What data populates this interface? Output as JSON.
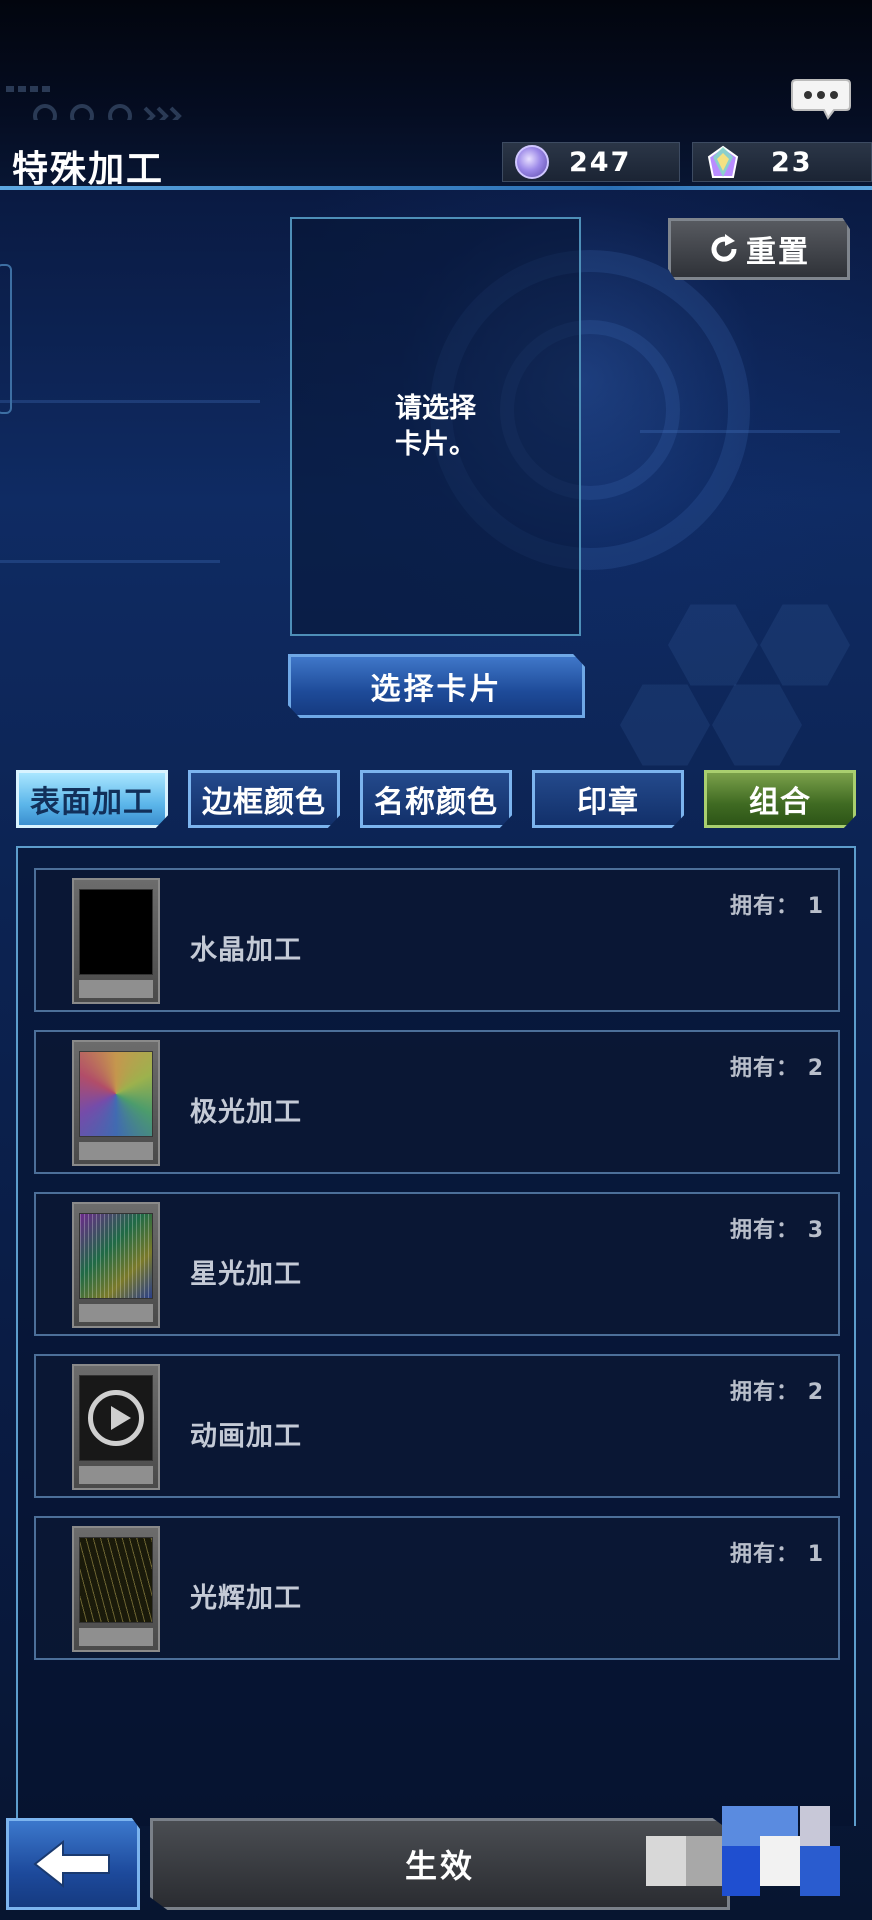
{
  "header": {
    "title": "特殊加工",
    "currencies": [
      {
        "name": "gem-currency",
        "value": "247"
      },
      {
        "name": "crystal-currency",
        "value": "23"
      }
    ]
  },
  "card_slot": {
    "prompt_line1": "请选择",
    "prompt_line2": "卡片。"
  },
  "reset_button": {
    "label": "重置"
  },
  "select_button": {
    "label": "选择卡片"
  },
  "tabs": [
    {
      "label": "表面加工",
      "state": "active"
    },
    {
      "label": "边框颜色",
      "state": "normal"
    },
    {
      "label": "名称颜色",
      "state": "normal"
    },
    {
      "label": "印章",
      "state": "normal"
    },
    {
      "label": "组合",
      "state": "green"
    }
  ],
  "owned_label": "拥有：",
  "items": [
    {
      "name": "水晶加工",
      "owned": "1",
      "art": "crystal"
    },
    {
      "name": "极光加工",
      "owned": "2",
      "art": "aurora"
    },
    {
      "name": "星光加工",
      "owned": "3",
      "art": "star"
    },
    {
      "name": "动画加工",
      "owned": "2",
      "art": "anim"
    },
    {
      "name": "光辉加工",
      "owned": "1",
      "art": "glow"
    }
  ],
  "bottom": {
    "apply_label": "生效"
  },
  "colors": {
    "accent_blue": "#3f77c9",
    "active_tab": "#5cb6ea",
    "green_tab": "#3f6a22",
    "panel_border": "#5d9dcc"
  }
}
